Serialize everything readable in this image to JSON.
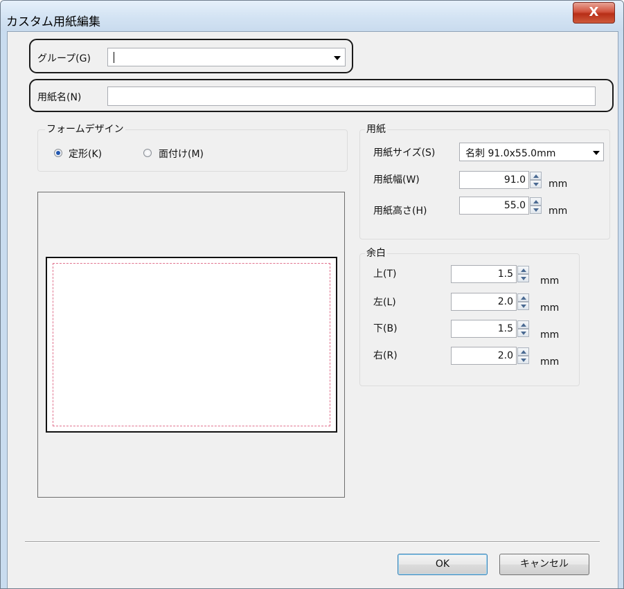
{
  "window": {
    "title": "カスタム用紙編集",
    "close_label": "X"
  },
  "group_field": {
    "label": "グループ(G)",
    "value": ""
  },
  "paper_name_field": {
    "label": "用紙名(N)",
    "value": ""
  },
  "form_design": {
    "title": "フォームデザイン",
    "options": [
      {
        "label": "定形(K)",
        "selected": true
      },
      {
        "label": "面付け(M)",
        "selected": false
      }
    ]
  },
  "paper": {
    "title": "用紙",
    "size_label": "用紙サイズ(S)",
    "size_value": "名刺 91.0x55.0mm",
    "width_label": "用紙幅(W)",
    "width_value": "91.0",
    "height_label": "用紙高さ(H)",
    "height_value": "55.0",
    "unit": "mm"
  },
  "margins": {
    "title": "余白",
    "unit": "mm",
    "items": [
      {
        "label": "上(T)",
        "value": "1.5"
      },
      {
        "label": "左(L)",
        "value": "2.0"
      },
      {
        "label": "下(B)",
        "value": "1.5"
      },
      {
        "label": "右(R)",
        "value": "2.0"
      }
    ]
  },
  "buttons": {
    "ok": "OK",
    "cancel": "キャンセル"
  },
  "colors": {
    "margin_guide": "#e0708c",
    "titlebar": "#d3e3f3",
    "close_button": "#c8472f"
  }
}
